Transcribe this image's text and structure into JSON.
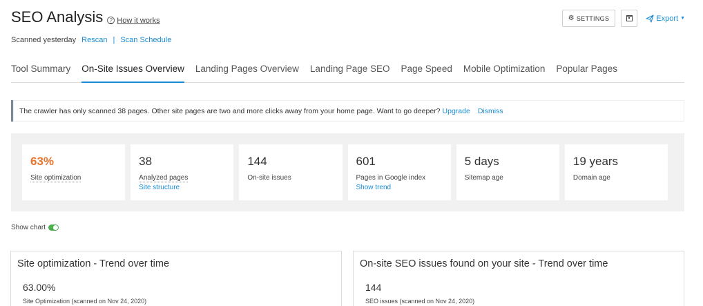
{
  "header": {
    "title": "SEO Analysis",
    "help_link": "How it works",
    "help_icon": "help-circle-icon",
    "settings_label": "SETTINGS",
    "settings_icon": "gear-icon",
    "calendar_icon": "calendar-icon",
    "export_label": "Export",
    "export_icon": "send-icon"
  },
  "scan": {
    "status": "Scanned yesterday",
    "rescan": "Rescan",
    "separator": "|",
    "schedule": "Scan Schedule"
  },
  "tabs": [
    {
      "label": "Tool Summary",
      "active": false
    },
    {
      "label": "On-Site Issues Overview",
      "active": true
    },
    {
      "label": "Landing Pages Overview",
      "active": false
    },
    {
      "label": "Landing Page SEO",
      "active": false
    },
    {
      "label": "Page Speed",
      "active": false
    },
    {
      "label": "Mobile Optimization",
      "active": false
    },
    {
      "label": "Popular Pages",
      "active": false
    }
  ],
  "notice": {
    "text": "The crawler has only scanned 38 pages. Other site pages are two and more clicks away from your home page. Want to go deeper?",
    "upgrade": "Upgrade",
    "dismiss": "Dismiss"
  },
  "metrics": [
    {
      "value": "63%",
      "label": "Site optimization",
      "link": ""
    },
    {
      "value": "38",
      "label": "Analyzed pages",
      "link": "Site structure"
    },
    {
      "value": "144",
      "label": "On-site issues",
      "link": ""
    },
    {
      "value": "601",
      "label": "Pages in Google index",
      "link": "Show trend"
    },
    {
      "value": "5 days",
      "label": "Sitemap age",
      "link": ""
    },
    {
      "value": "19 years",
      "label": "Domain age",
      "link": ""
    }
  ],
  "show_chart": {
    "label": "Show chart",
    "enabled": true
  },
  "panels": [
    {
      "title": "Site optimization - Trend over time",
      "value": "63.00%",
      "caption": "Site Optimization (scanned on Nov 24, 2020)"
    },
    {
      "title": "On-site SEO issues found on your site - Trend over time",
      "value": "144",
      "caption": "SEO issues (scanned on Nov 24, 2020)"
    }
  ],
  "colors": {
    "accent": "#1a8bd3",
    "highlight_orange": "#e9732b",
    "toggle_on": "#4caf50"
  }
}
